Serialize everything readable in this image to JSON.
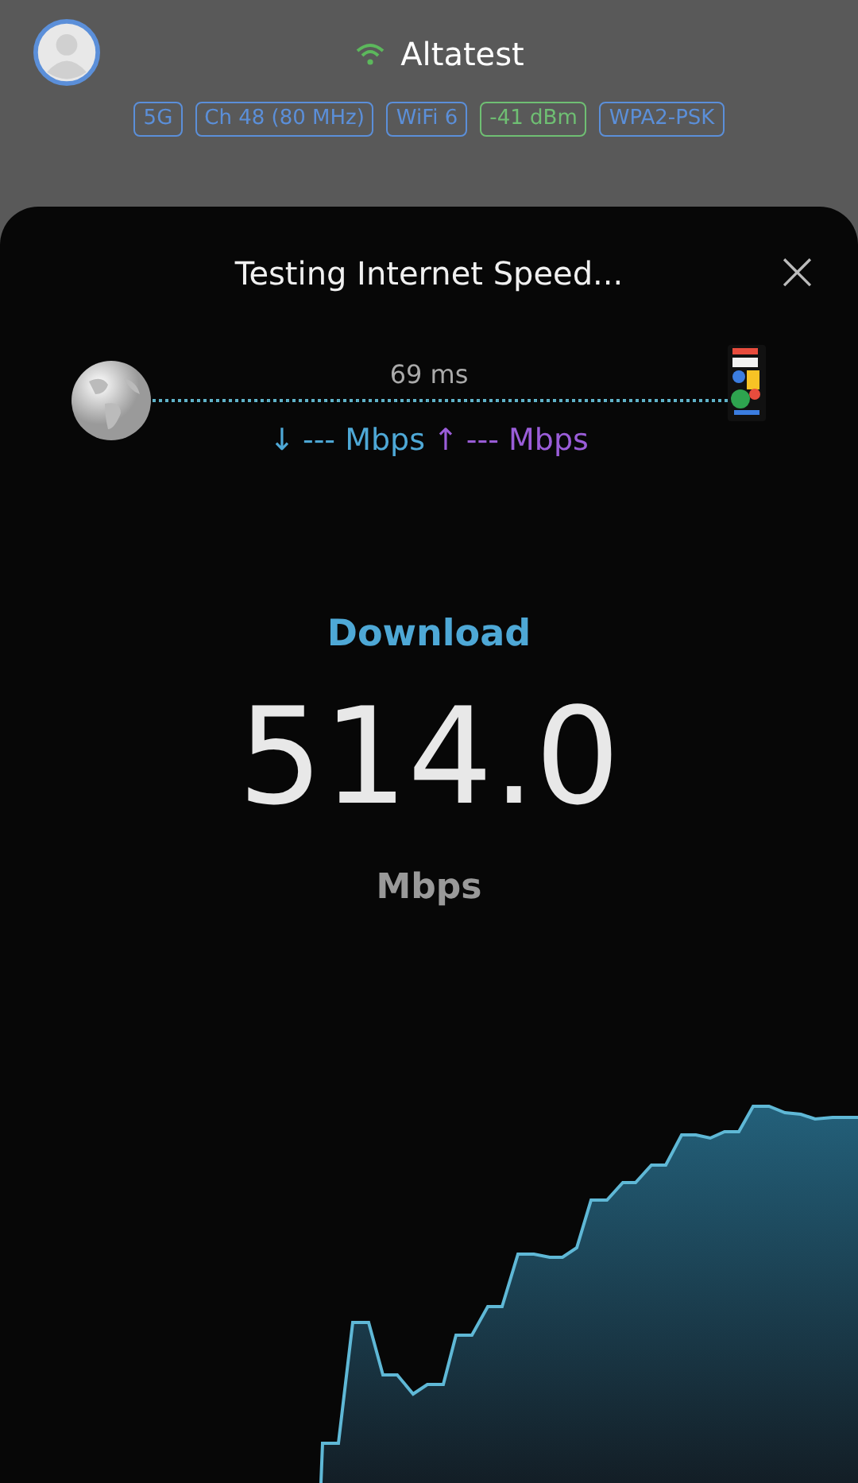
{
  "network": {
    "name": "Altatest",
    "tags": [
      {
        "label": "5G",
        "color": "#5b8fd9"
      },
      {
        "label": "Ch 48 (80 MHz)",
        "color": "#5b8fd9"
      },
      {
        "label": "WiFi 6",
        "color": "#5b8fd9"
      },
      {
        "label": "-41 dBm",
        "color": "#6fbf73"
      },
      {
        "label": "WPA2-PSK",
        "color": "#5b8fd9"
      }
    ]
  },
  "dialog": {
    "title": "Testing Internet Speed...",
    "close": "×",
    "ping": "69 ms",
    "down_arrow": "↓",
    "down_reading": "--- Mbps",
    "up_arrow": "↑",
    "up_reading": "--- Mbps",
    "phase": "Download",
    "speed": "514.0",
    "unit": "Mbps"
  }
}
